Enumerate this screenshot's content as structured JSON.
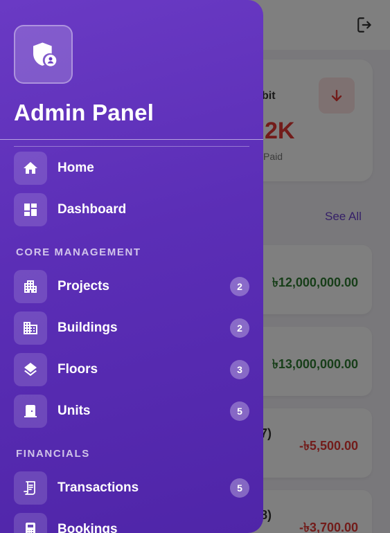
{
  "background": {
    "debit_card": {
      "label_fragment": "bit",
      "value_fragment": "2K",
      "sub_fragment": "Paid"
    },
    "see_all": "See All",
    "transactions": [
      {
        "label_fragment": "",
        "amount": "৳12,000,000.00",
        "sign": "pos"
      },
      {
        "label_fragment": "",
        "amount": "৳13,000,000.00",
        "sign": "pos"
      },
      {
        "label_fragment": "7)",
        "amount": "-৳5,500.00",
        "sign": "neg"
      },
      {
        "label_fragment": "8)",
        "amount": "-৳3,700.00",
        "sign": "neg"
      }
    ]
  },
  "drawer": {
    "title": "Admin Panel",
    "logo_icon": "shield-user-icon",
    "items_top": [
      {
        "label": "Home",
        "icon": "home-icon"
      },
      {
        "label": "Dashboard",
        "icon": "dashboard-icon"
      }
    ],
    "sections": [
      {
        "heading": "CORE MANAGEMENT",
        "items": [
          {
            "label": "Projects",
            "icon": "apartment-icon",
            "badge": "2"
          },
          {
            "label": "Buildings",
            "icon": "building-icon",
            "badge": "2"
          },
          {
            "label": "Floors",
            "icon": "layers-icon",
            "badge": "3"
          },
          {
            "label": "Units",
            "icon": "door-icon",
            "badge": "5"
          }
        ]
      },
      {
        "heading": "FINANCIALS",
        "items": [
          {
            "label": "Transactions",
            "icon": "receipt-icon",
            "badge": "5"
          },
          {
            "label": "Bookings",
            "icon": "booking-icon",
            "badge": ""
          }
        ]
      }
    ]
  },
  "colors": {
    "drawer_gradient_start": "#6a3ac4",
    "drawer_gradient_end": "#4f25a8",
    "positive_amount": "#2e7d32",
    "negative_amount": "#e53935",
    "accent": "#6a3fcf"
  }
}
